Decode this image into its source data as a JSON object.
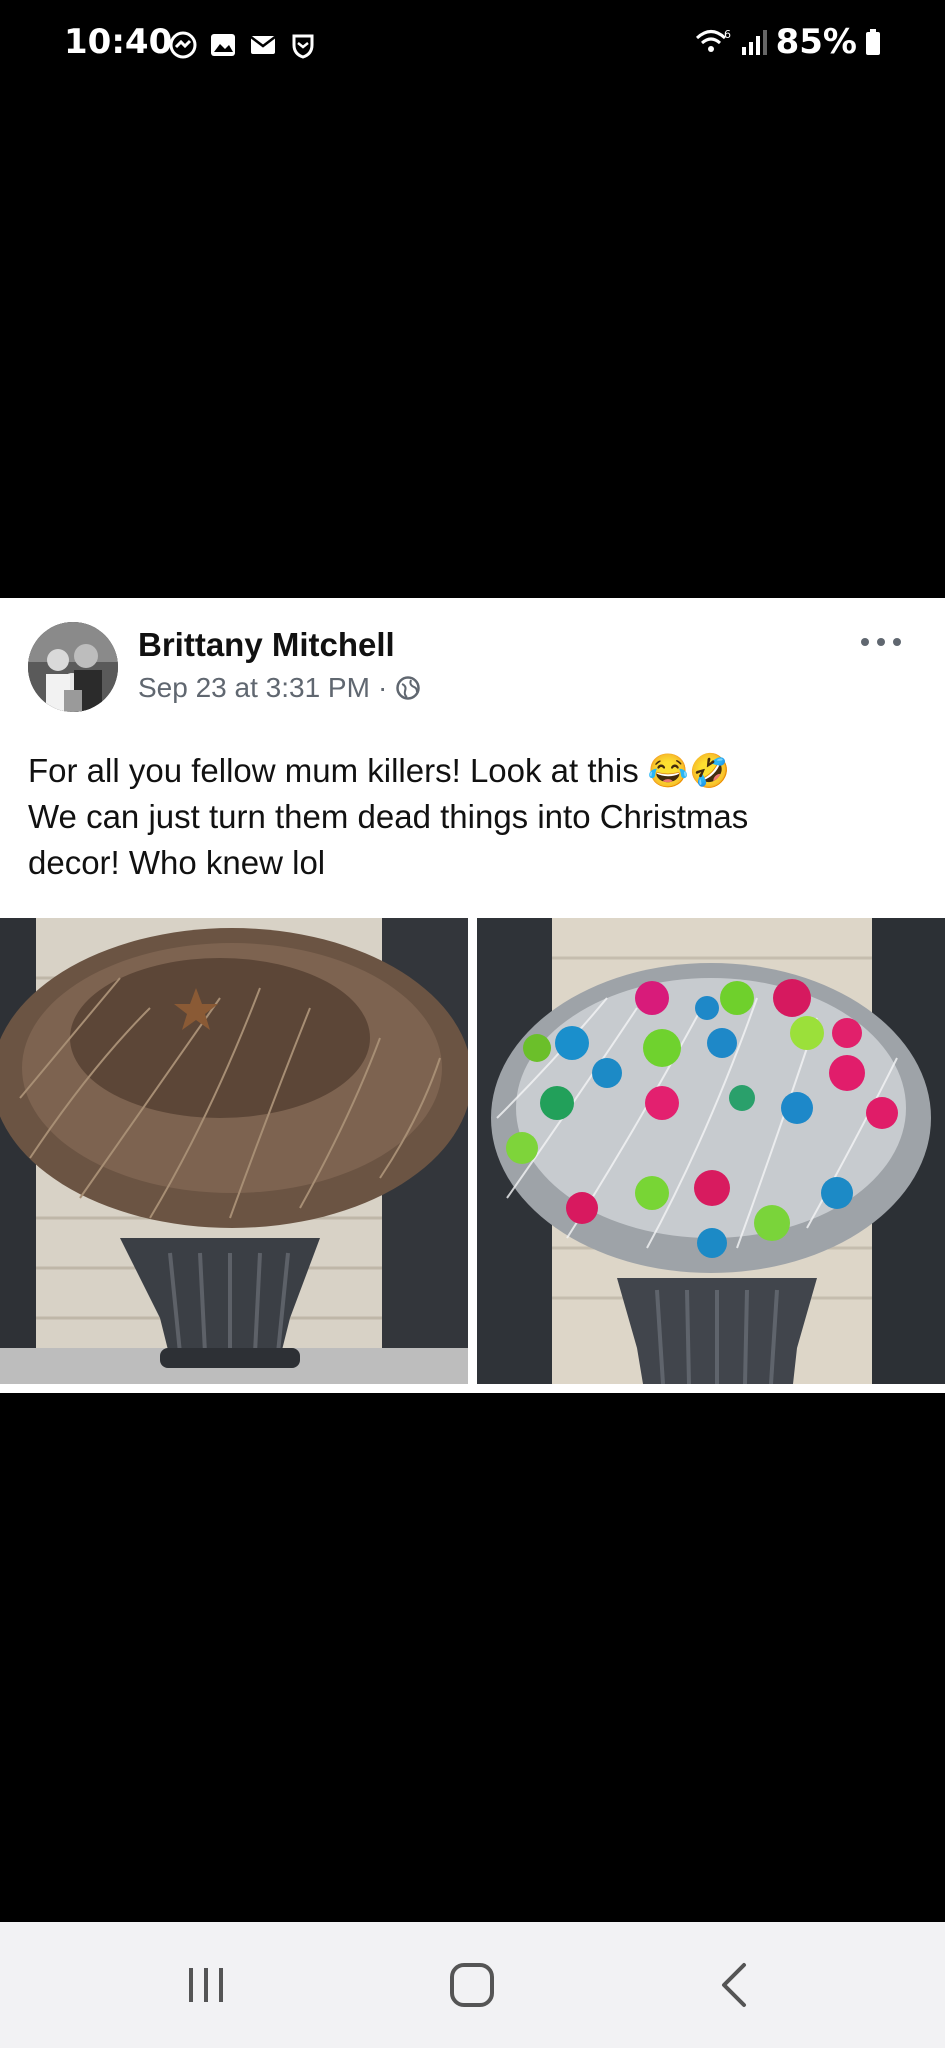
{
  "status_bar": {
    "time": "10:40",
    "battery": "85%",
    "network_badge": "6"
  },
  "post": {
    "author": "Brittany Mitchell",
    "date": "Sep 23 at 3:31 PM",
    "separator": "·",
    "text_line1": "For all you fellow mum killers! Look at this",
    "text_line2": "We can just turn them dead things into Christmas",
    "text_line3": "decor! Who knew lol",
    "emojis": "😂🤣"
  },
  "colors": {
    "card_background": "#ffffff",
    "meta_text": "#606770",
    "nav_background": "#f2f2f4"
  }
}
